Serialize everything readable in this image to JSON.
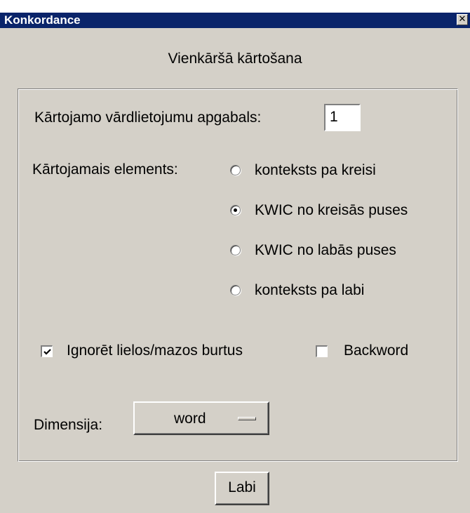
{
  "window": {
    "title": "Konkordance",
    "close_glyph": "✕"
  },
  "heading": "Vienkāršā kārtošana",
  "range": {
    "label": "Kārtojamo vārdlietojumu apgabals:",
    "value": "1"
  },
  "sort_element": {
    "label": "Kārtojamais elements:",
    "options": [
      {
        "label": "konteksts pa kreisi",
        "selected": false
      },
      {
        "label": "KWIC no kreisās puses",
        "selected": true
      },
      {
        "label": "KWIC no labās puses",
        "selected": false
      },
      {
        "label": "konteksts pa labi",
        "selected": false
      }
    ]
  },
  "checkboxes": {
    "ignore_case": {
      "label": "Ignorēt lielos/mazos burtus",
      "checked": true
    },
    "backword": {
      "label": "Backword",
      "checked": false
    }
  },
  "dimension": {
    "label": "Dimensija:",
    "value": "word"
  },
  "ok_button": "Labi"
}
